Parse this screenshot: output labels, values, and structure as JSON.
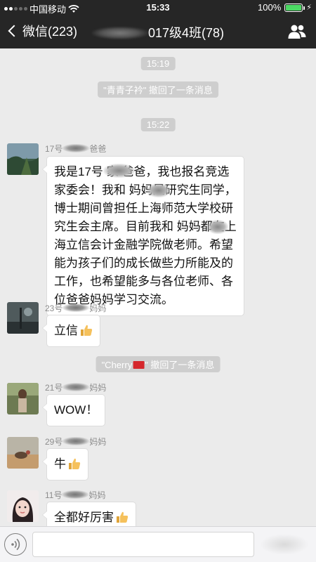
{
  "status": {
    "carrier": "中国移动",
    "time": "15:33",
    "battery": "100%",
    "battery_level": 1.0
  },
  "nav": {
    "back_label": "微信(223)",
    "title": "017级4班(78)",
    "people_icon": "group-members-icon"
  },
  "chat": {
    "time_1": "15:19",
    "recall_1": "\"青青子衿\" 撤回了一条消息",
    "time_2": "15:22",
    "recall_2_prefix": "\"Cherry",
    "recall_2_suffix": "\" 撤回了一条消息",
    "messages": [
      {
        "nick_prefix": "17号",
        "nick_suffix": "爸爸",
        "text": "我是17号 家 爸爸，我也报名竞选家委会！我和 妈妈是研究生同学，博士期间曾担任上海师范大学校研究生会主席。目前我和 妈妈都在上海立信会计金融学院做老师。希望能为孩子们的成长做些力所能及的工作，也希望能多与各位老师、各位爸爸妈妈学习交流。"
      },
      {
        "nick_prefix": "23号",
        "nick_suffix": "妈妈",
        "text": "立信"
      },
      {
        "nick_prefix": "21号",
        "nick_suffix": "妈妈",
        "text": "WOW！"
      },
      {
        "nick_prefix": "29号",
        "nick_suffix": "妈妈",
        "text": "牛"
      },
      {
        "nick_prefix": "11号",
        "nick_suffix": "妈妈",
        "text": "全都好厉害"
      }
    ]
  },
  "input": {
    "placeholder": "",
    "voice_icon": "voice-input-icon"
  },
  "colors": {
    "bar_bg": "#262626",
    "chat_bg": "#ebebeb",
    "pill_bg": "#cecece",
    "bubble_bg": "#ffffff",
    "battery_green": "#4cd964"
  }
}
